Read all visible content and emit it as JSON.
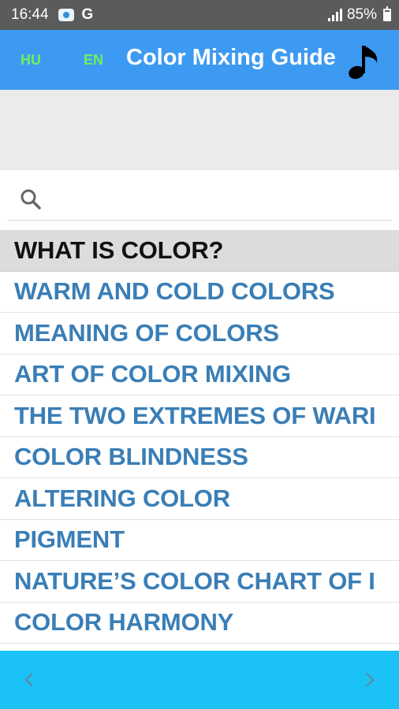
{
  "status_bar": {
    "time": "16:44",
    "g_label": "G",
    "battery_percent": "85%"
  },
  "app_bar": {
    "lang_hu": "HU",
    "lang_en": "EN",
    "title": "Color Mixing Guide",
    "music_icon": "music-note-icon"
  },
  "search": {
    "placeholder": "",
    "value": "",
    "icon": "search-icon"
  },
  "topics": [
    {
      "label": "WHAT IS COLOR?",
      "selected": true
    },
    {
      "label": "WARM AND COLD COLORS",
      "selected": false
    },
    {
      "label": "MEANING OF COLORS",
      "selected": false
    },
    {
      "label": "ART OF COLOR MIXING",
      "selected": false
    },
    {
      "label": "THE TWO EXTREMES OF WARI",
      "selected": false
    },
    {
      "label": "COLOR BLINDNESS",
      "selected": false
    },
    {
      "label": "ALTERING COLOR",
      "selected": false
    },
    {
      "label": "PIGMENT",
      "selected": false
    },
    {
      "label": "NATURE’S COLOR CHART OF I",
      "selected": false
    },
    {
      "label": "COLOR HARMONY",
      "selected": false
    }
  ],
  "bottom_nav": {
    "prev_icon": "chevron-left-icon",
    "next_icon": "chevron-right-icon"
  },
  "colors": {
    "status_bar": "#5b5b5b",
    "app_bar": "#3d9af2",
    "lang_text": "#6df05a",
    "topic_text": "#3a7eb6",
    "selected_bg": "#dcdcdc",
    "bottom_bar": "#1ac2f7"
  }
}
